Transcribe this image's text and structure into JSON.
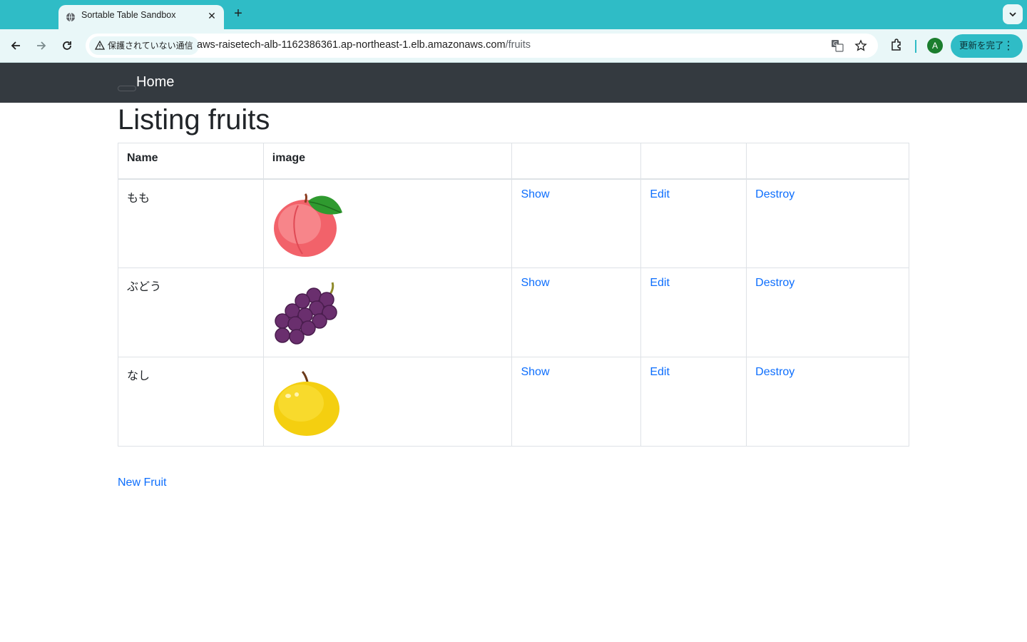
{
  "browser": {
    "tab_title": "Sortable Table Sandbox",
    "security_label": "保護されていない通信",
    "url_host": "aws-raisetech-alb-1162386361.ap-northeast-1.elb.amazonaws.com",
    "url_path": "/fruits",
    "profile_initial": "A",
    "update_label": "更新を完了"
  },
  "navbar": {
    "brand": "Home"
  },
  "page": {
    "title": "Listing fruits",
    "new_link": "New Fruit"
  },
  "table": {
    "headers": [
      "Name",
      "image",
      "",
      "",
      ""
    ],
    "rows": [
      {
        "name": "もも",
        "image_icon": "peach-icon",
        "show": "Show",
        "edit": "Edit",
        "destroy": "Destroy"
      },
      {
        "name": "ぶどう",
        "image_icon": "grape-icon",
        "show": "Show",
        "edit": "Edit",
        "destroy": "Destroy"
      },
      {
        "name": "なし",
        "image_icon": "pear-icon",
        "show": "Show",
        "edit": "Edit",
        "destroy": "Destroy"
      }
    ]
  },
  "colors": {
    "chrome_accent": "#2fbcc6",
    "navbar_bg": "#343a40",
    "link": "#0d6efd"
  }
}
